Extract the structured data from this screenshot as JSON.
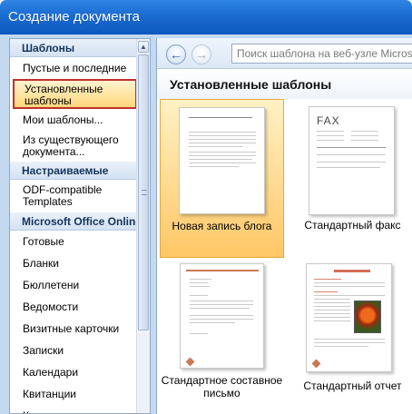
{
  "window": {
    "title": "Создание документа"
  },
  "sidebar": {
    "templates_header": "Шаблоны",
    "items": [
      {
        "label": "Пустые и последние"
      },
      {
        "label_line1": "Установленные",
        "label_line2": "шаблоны",
        "selected": true
      },
      {
        "label": "Мои шаблоны..."
      },
      {
        "label_line1": "Из существующего",
        "label_line2": "документа..."
      }
    ],
    "custom_header": "Настраиваемые",
    "custom_items": [
      {
        "label_line1": "ODF-compatible",
        "label_line2": "Templates"
      }
    ],
    "online_header": "Microsoft Office Online",
    "online_items": [
      {
        "label": "Готовые"
      },
      {
        "label": "Бланки"
      },
      {
        "label": "Бюллетени"
      },
      {
        "label": "Ведомости"
      },
      {
        "label": "Визитные карточки"
      },
      {
        "label": "Записки"
      },
      {
        "label": "Календари"
      },
      {
        "label": "Квитанции"
      },
      {
        "label": "Конверты"
      }
    ]
  },
  "toolbar": {
    "search_placeholder": "Поиск шаблона на веб-узле Microsoft",
    "back_glyph": "←",
    "forward_glyph": "→"
  },
  "main": {
    "section_title": "Установленные шаблоны",
    "templates": [
      {
        "label": "Новая запись блога",
        "selected": true
      },
      {
        "label": "Стандартный факс",
        "fax_text": "FAX"
      },
      {
        "label_line1": "Стандартное составное",
        "label_line2": "письмо"
      },
      {
        "label": "Стандартный отчет"
      }
    ]
  },
  "colors": {
    "title_bar": "#1a6bd0",
    "selection_fill": "#ffd77c",
    "selection_border": "#c0302c",
    "accent_red": "#d9806e"
  }
}
